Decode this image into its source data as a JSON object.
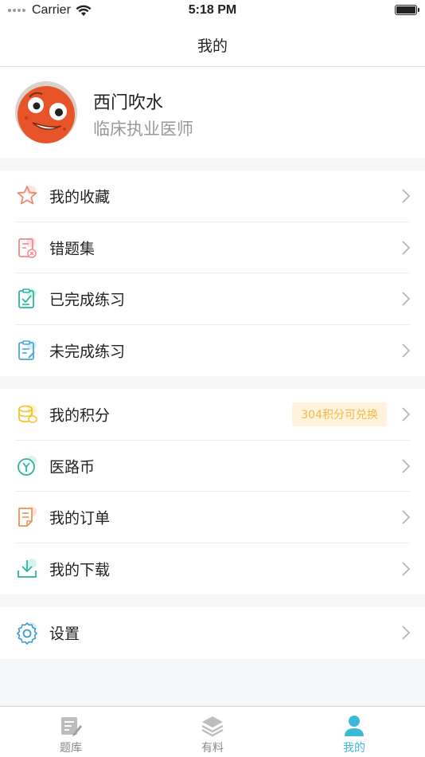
{
  "status_bar": {
    "carrier": "Carrier",
    "time": "5:18 PM"
  },
  "nav": {
    "title": "我的"
  },
  "profile": {
    "name": "西门吹水",
    "role": "临床执业医师"
  },
  "menu_groups": [
    {
      "items": [
        {
          "label": "我的收藏",
          "icon": "star-icon"
        },
        {
          "label": "错题集",
          "icon": "wrong-questions-icon"
        },
        {
          "label": "已完成练习",
          "icon": "completed-clipboard-icon"
        },
        {
          "label": "未完成练习",
          "icon": "incomplete-clipboard-icon"
        }
      ]
    },
    {
      "items": [
        {
          "label": "我的积分",
          "icon": "coins-icon",
          "badge": "304积分可兑换"
        },
        {
          "label": "医路币",
          "icon": "yilu-coin-icon"
        },
        {
          "label": "我的订单",
          "icon": "order-document-icon"
        },
        {
          "label": "我的下载",
          "icon": "download-icon"
        }
      ]
    },
    {
      "items": [
        {
          "label": "设置",
          "icon": "settings-gear-icon"
        }
      ]
    }
  ],
  "tabbar": {
    "tabs": [
      {
        "label": "题库",
        "icon": "question-bank-icon",
        "active": false
      },
      {
        "label": "有料",
        "icon": "layers-icon",
        "active": false
      },
      {
        "label": "我的",
        "icon": "user-icon",
        "active": true
      }
    ]
  },
  "colors": {
    "accent": "#3db9d8",
    "badge_bg": "#fff3dc",
    "badge_text": "#f5b84a",
    "separator_bg": "#f5f6f7"
  }
}
